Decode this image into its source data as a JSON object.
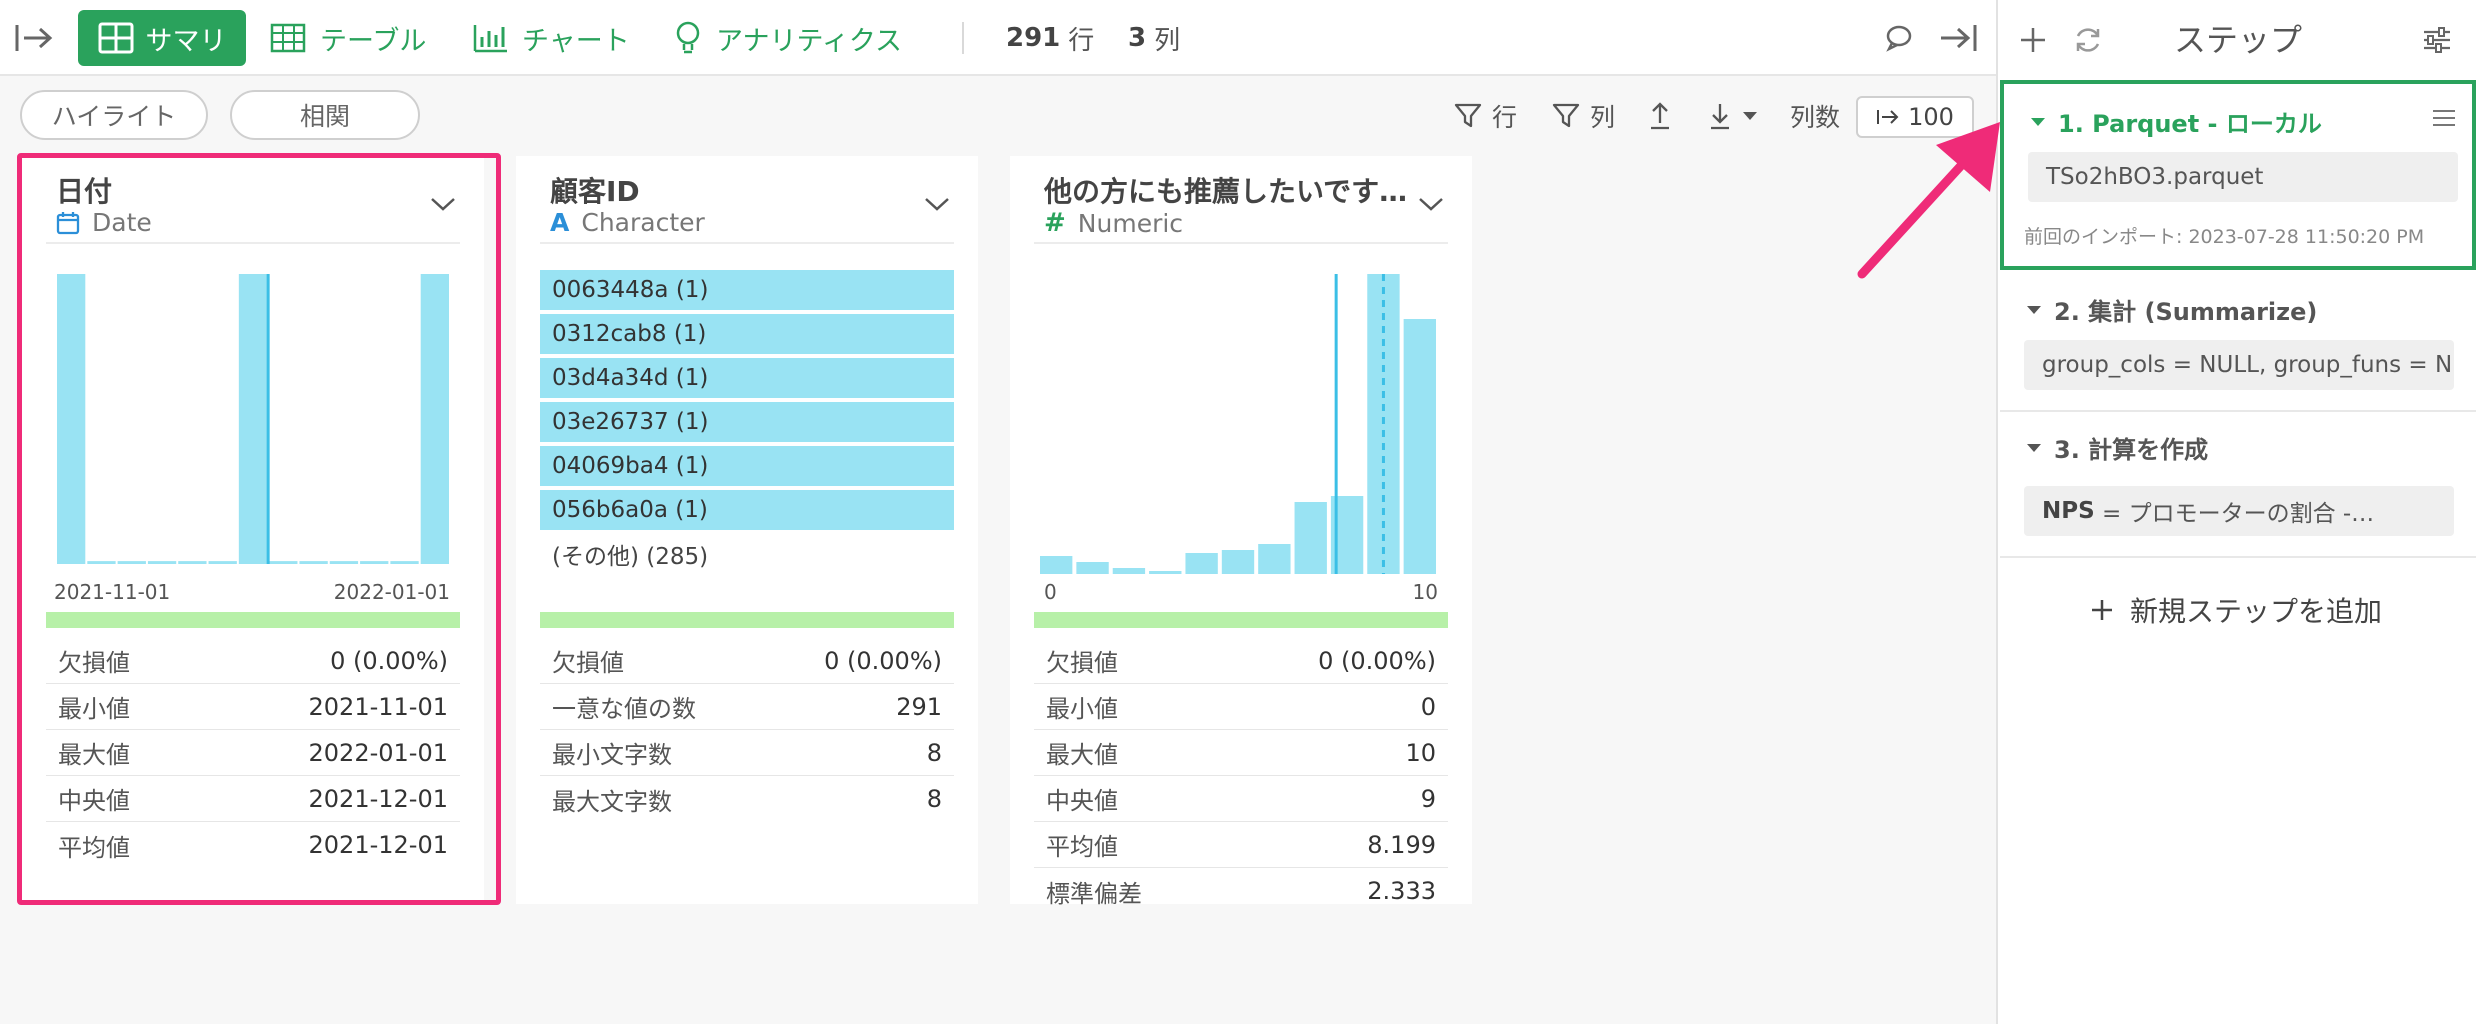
{
  "toolbar": {
    "tabs": [
      {
        "label": "サマリ",
        "icon": "grid-icon",
        "active": true
      },
      {
        "label": "テーブル",
        "icon": "table-icon"
      },
      {
        "label": "チャート",
        "icon": "bar-chart-icon"
      },
      {
        "label": "アナリティクス",
        "icon": "lightbulb-icon"
      }
    ],
    "row_count": "291",
    "row_unit": "行",
    "col_count": "3",
    "col_unit": "列",
    "accent_color": "#2aa25c"
  },
  "subtoolbar": {
    "highlight_label": "ハイライト",
    "correlation_label": "相関",
    "filter_row_label": "行",
    "filter_col_label": "列",
    "col_count_label": "列数",
    "col_count_value": "100"
  },
  "columns": [
    {
      "title": "日付",
      "type_label": "Date",
      "type_icon": "calendar-icon",
      "chart_data": {
        "type": "bar",
        "values": [
          100,
          1,
          1,
          1,
          1,
          1,
          100,
          1,
          1,
          1,
          1,
          1,
          100
        ],
        "axis_labels": [
          "2021-11-01",
          "2022-01-01"
        ],
        "marker_index": 6.8
      },
      "stats": [
        {
          "label": "欠損値",
          "value": "0 (0.00%)"
        },
        {
          "label": "最小値",
          "value": "2021-11-01"
        },
        {
          "label": "最大値",
          "value": "2022-01-01"
        },
        {
          "label": "中央値",
          "value": "2021-12-01"
        },
        {
          "label": "平均値",
          "value": "2021-12-01"
        }
      ]
    },
    {
      "title": "顧客ID",
      "type_label": "Character",
      "type_icon": "text-a-icon",
      "top_values": [
        "0063448a (1)",
        "0312cab8 (1)",
        "03d4a34d (1)",
        "03e26737 (1)",
        "04069ba4 (1)",
        "056b6a0a (1)"
      ],
      "other_label": "(その他) (285)",
      "stats": [
        {
          "label": "欠損値",
          "value": "0 (0.00%)"
        },
        {
          "label": "一意な値の数",
          "value": "291"
        },
        {
          "label": "最小文字数",
          "value": "8"
        },
        {
          "label": "最大文字数",
          "value": "8"
        }
      ]
    },
    {
      "title": "他の方にも推薦したいです…",
      "type_label": "Numeric",
      "type_icon": "hash-icon",
      "chart_data": {
        "type": "bar",
        "values": [
          6,
          4,
          2,
          1,
          7,
          8,
          10,
          24,
          26,
          100,
          85
        ],
        "axis_labels": [
          "0",
          "10"
        ],
        "median": 9,
        "mean": 8.199,
        "xlim": [
          0,
          11
        ]
      },
      "stats": [
        {
          "label": "欠損値",
          "value": "0 (0.00%)"
        },
        {
          "label": "最小値",
          "value": "0"
        },
        {
          "label": "最大値",
          "value": "10"
        },
        {
          "label": "中央値",
          "value": "9"
        },
        {
          "label": "平均値",
          "value": "8.199"
        },
        {
          "label": "標準偏差",
          "value": "2.333"
        }
      ]
    }
  ],
  "steps_panel": {
    "title": "ステップ",
    "steps": [
      {
        "title": "1. Parquet - ローカル",
        "box": "TSo2hBO3.parquet",
        "note": "前回のインポート: 2023-07-28 11:50:20 PM"
      },
      {
        "title": "2. 集計 (Summarize)",
        "box": "group_cols = NULL, group_funs = N…"
      },
      {
        "title": "3. 計算を作成",
        "box_key": "NPS",
        "box": " = プロモーターの割合 -…"
      }
    ],
    "add_step_label": "新規ステップを追加"
  },
  "colors": {
    "accent": "#2aa25c",
    "bar": "#99e3f3",
    "highlight": "#ef2b78",
    "distribution": "#b7f0a8"
  }
}
